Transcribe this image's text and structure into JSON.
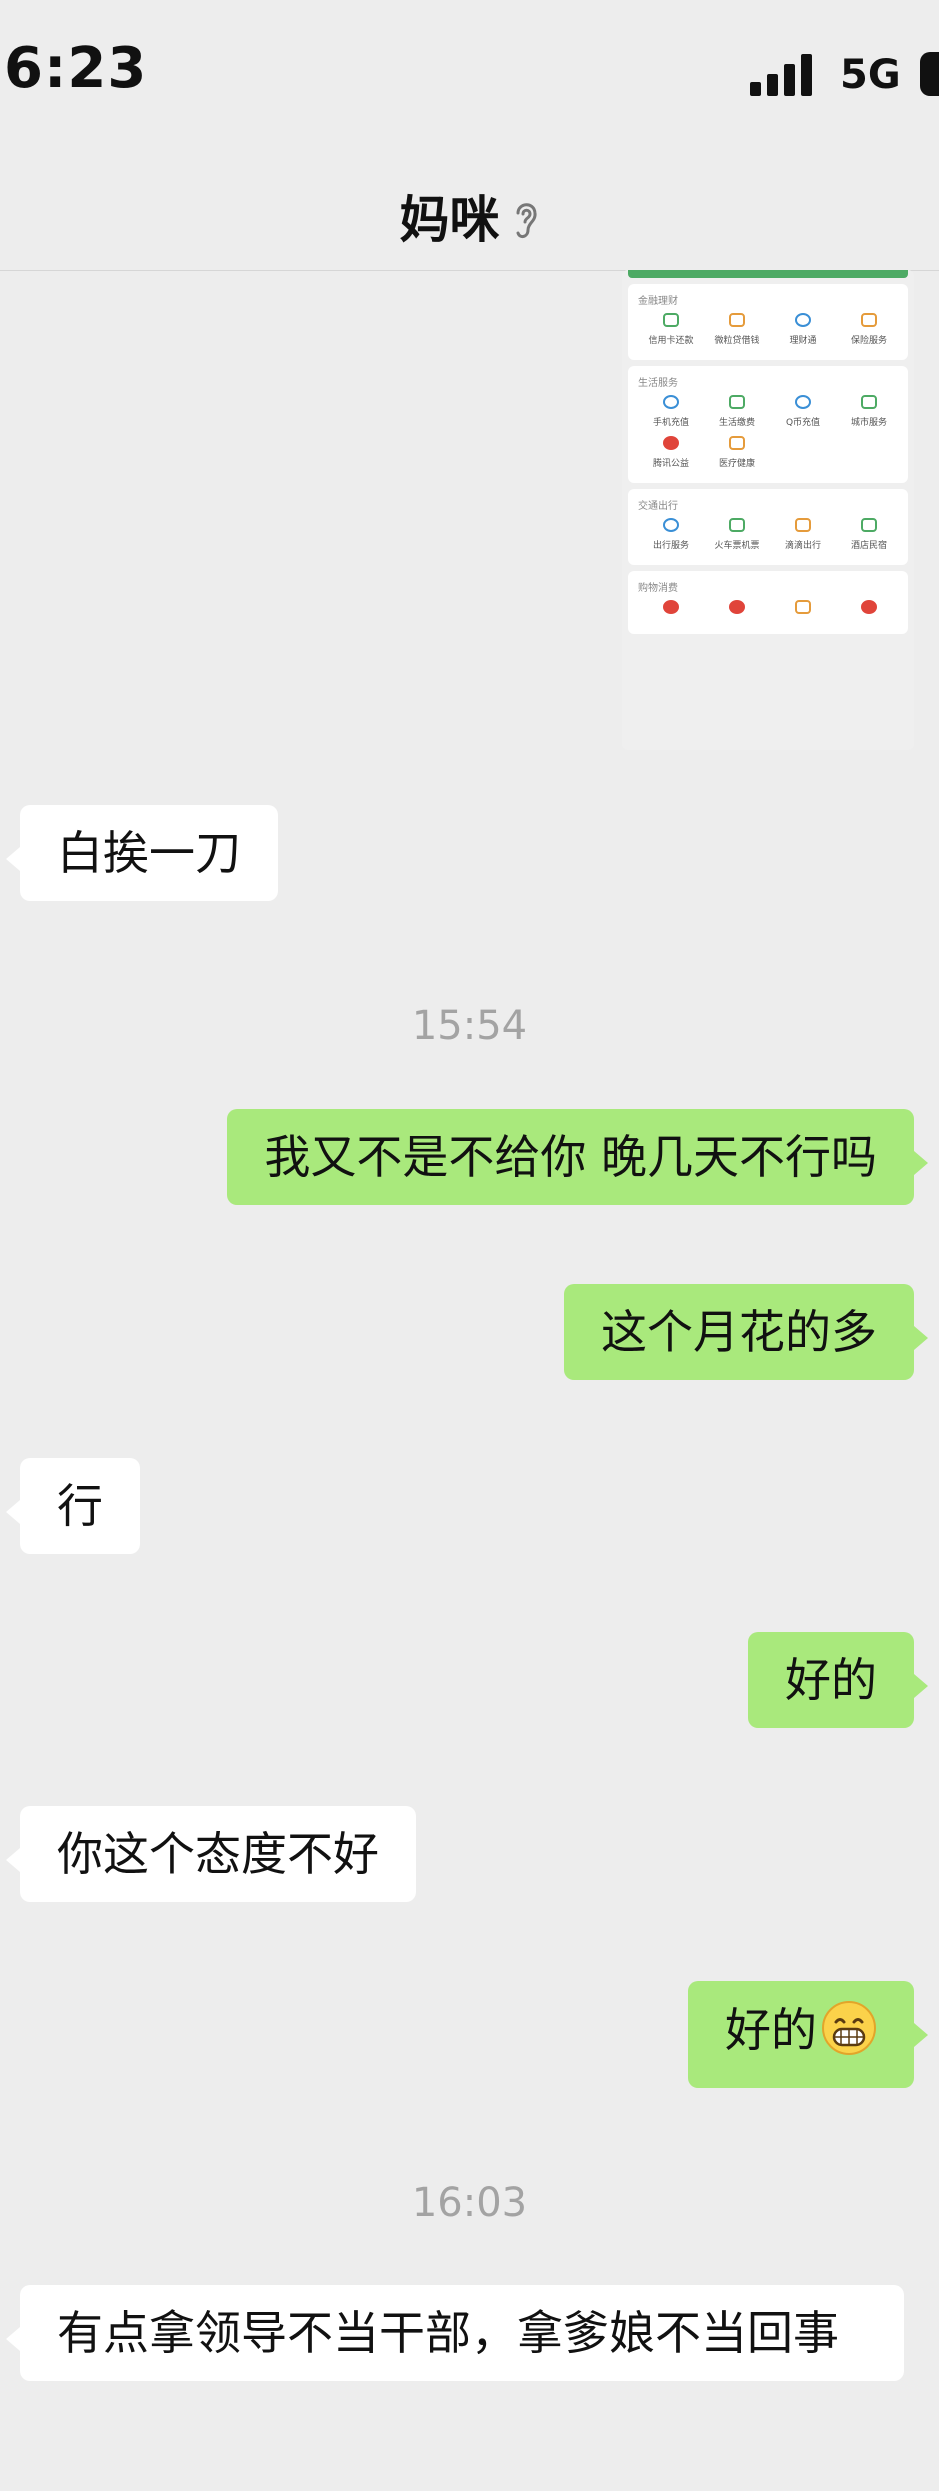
{
  "status_bar": {
    "time": "6:23",
    "network": "5G"
  },
  "nav": {
    "title": "妈咪"
  },
  "shared_screenshot": {
    "sections": [
      {
        "title": "金融理财",
        "items": [
          "信用卡还款",
          "微粒贷借钱",
          "理财通",
          "保险服务"
        ]
      },
      {
        "title": "生活服务",
        "items": [
          "手机充值",
          "生活缴费",
          "Q币充值",
          "城市服务",
          "腾讯公益",
          "医疗健康"
        ]
      },
      {
        "title": "交通出行",
        "items": [
          "出行服务",
          "火车票机票",
          "滴滴出行",
          "酒店民宿"
        ]
      },
      {
        "title": "购物消费",
        "items": []
      }
    ]
  },
  "messages": [
    {
      "side": "in",
      "text": "白挨一刀"
    },
    {
      "type": "time",
      "text": "15:54"
    },
    {
      "side": "out",
      "text": "我又不是不给你 晚几天不行吗"
    },
    {
      "side": "out",
      "text": "这个月花的多"
    },
    {
      "side": "in",
      "text": "行"
    },
    {
      "side": "out",
      "text": "好的"
    },
    {
      "side": "in",
      "text": "你这个态度不好"
    },
    {
      "side": "out",
      "text": "好的",
      "emoji": "grinning-face"
    },
    {
      "type": "time",
      "text": "16:03"
    },
    {
      "side": "in",
      "text": "有点拿领导不当干部，拿爹娘不当回事"
    }
  ]
}
